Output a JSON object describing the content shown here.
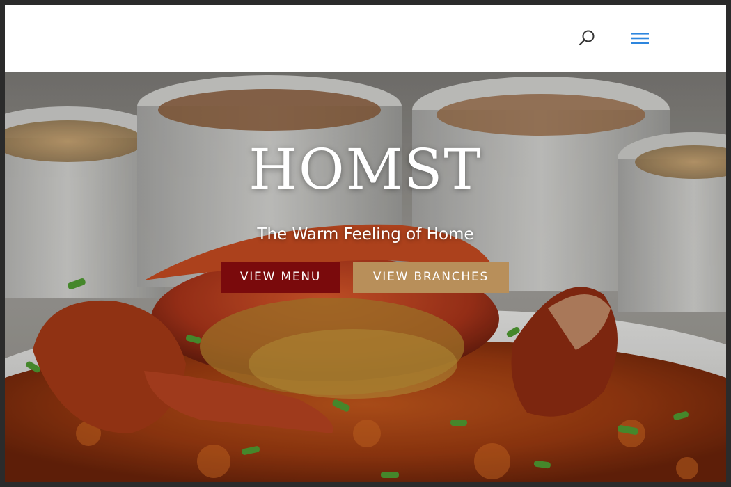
{
  "header": {
    "search_icon": "search-icon",
    "menu_icon": "hamburger-menu-icon",
    "accent_color": "#2e86de"
  },
  "hero": {
    "title": "HOMST",
    "subtitle": "The Warm Feeling of Home",
    "buttons": {
      "view_menu": "VIEW MENU",
      "view_branches": "VIEW BRANCHES"
    },
    "colors": {
      "view_menu_bg": "#7a0a0c",
      "view_branches_bg": "#b88f5a"
    },
    "background_image": "chili crab dish with bowls"
  }
}
